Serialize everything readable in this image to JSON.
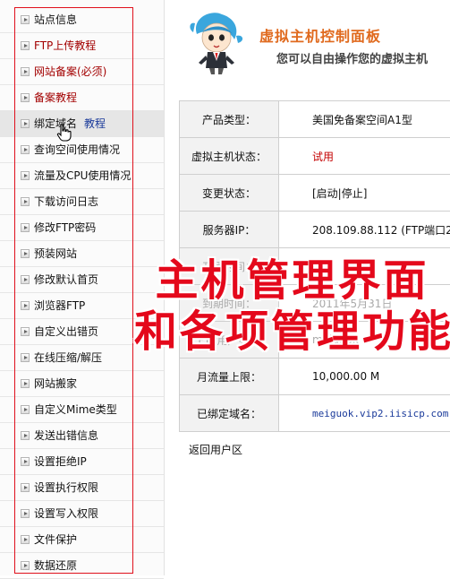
{
  "sidebar": {
    "items": [
      {
        "label": "站点信息",
        "red": false
      },
      {
        "label": "FTP上传教程",
        "red": true
      },
      {
        "label": "网站备案(必须)",
        "red": true
      },
      {
        "label": "备案教程",
        "red": true
      },
      {
        "label": "绑定域名",
        "red": false,
        "extra": "教程"
      },
      {
        "label": "查询空间使用情况",
        "red": false
      },
      {
        "label": "流量及CPU使用情况",
        "red": false
      },
      {
        "label": "下载访问日志",
        "red": false
      },
      {
        "label": "修改FTP密码",
        "red": false
      },
      {
        "label": "预装网站",
        "red": false
      },
      {
        "label": "修改默认首页",
        "red": false
      },
      {
        "label": "浏览器FTP",
        "red": false
      },
      {
        "label": "自定义出错页",
        "red": false
      },
      {
        "label": "在线压缩/解压",
        "red": false
      },
      {
        "label": "网站搬家",
        "red": false
      },
      {
        "label": "自定义Mime类型",
        "red": false
      },
      {
        "label": "发送出错信息",
        "red": false
      },
      {
        "label": "设置拒绝IP",
        "red": false
      },
      {
        "label": "设置执行权限",
        "red": false
      },
      {
        "label": "设置写入权限",
        "red": false
      },
      {
        "label": "文件保护",
        "red": false
      },
      {
        "label": "数据还原",
        "red": false
      }
    ]
  },
  "header": {
    "title": "虚拟主机控制面板",
    "subtitle": "您可以自由操作您的虚拟主机"
  },
  "info": {
    "rows": [
      {
        "key": "产品类型：",
        "value": "美国免备案空间A1型"
      },
      {
        "key": "虚拟主机状态：",
        "value": "试用"
      },
      {
        "key": "变更状态：",
        "value": "[启动|停止]"
      },
      {
        "key": "服务器IP：",
        "value": "208.109.88.112 (FTP端口21)"
      },
      {
        "key": "开通时间：",
        "value": ""
      },
      {
        "key": "到期时间：",
        "value": "2011年5月31日"
      },
      {
        "key": "FTP用户名：",
        "value": "meiguok"
      },
      {
        "key": "月流量上限：",
        "value": "10,000.00 M"
      },
      {
        "key": "已绑定域名：",
        "value": "meiguok.vip2.iisicp.com"
      }
    ]
  },
  "back_link": "返回用户区",
  "overlay": {
    "line1": "主机管理界面",
    "line2": "和各项管理功能"
  },
  "colors": {
    "accent_red": "#e4081b",
    "title_orange": "#e06a1e",
    "link_blue": "#1a3a9a"
  }
}
